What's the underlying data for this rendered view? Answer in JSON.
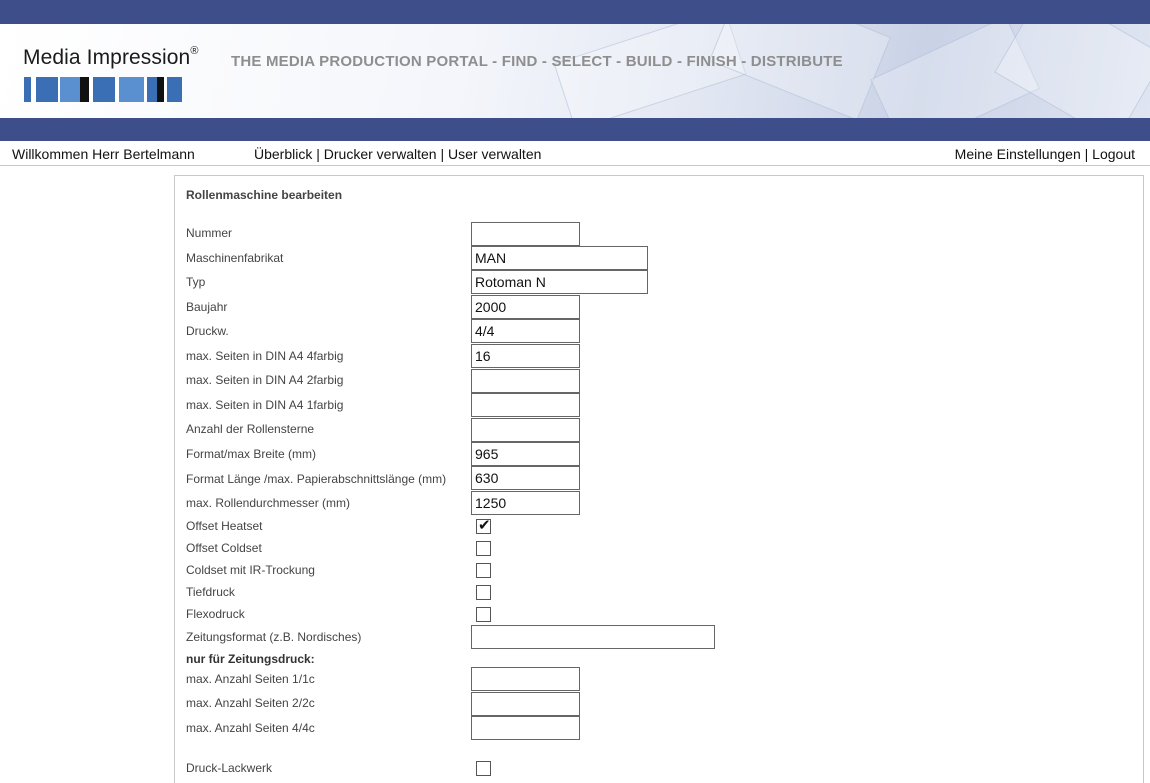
{
  "header": {
    "logo_text": "Media Impression",
    "logo_mark": "®",
    "tagline": "THE MEDIA PRODUCTION PORTAL - FIND - SELECT - BUILD - FINISH - DISTRIBUTE",
    "colors": {
      "stripe": "#3d4e8a",
      "block_blue": "#3a6fb5",
      "block_light": "#5a8fd0",
      "block_black": "#111111"
    }
  },
  "nav": {
    "welcome": "Willkommen Herr Bertelmann",
    "overview": "Überblick",
    "printers": "Drucker verwalten",
    "users": "User verwalten",
    "separator": " | ",
    "settings": "Meine Einstellungen",
    "logout": "Logout"
  },
  "form": {
    "title": "Rollenmaschine bearbeiten",
    "fields": {
      "nummer": {
        "label": "Nummer",
        "value": ""
      },
      "fabrikat": {
        "label": "Maschinenfabrikat",
        "value": "MAN"
      },
      "typ": {
        "label": "Typ",
        "value": "Rotoman N"
      },
      "baujahr": {
        "label": "Baujahr",
        "value": "2000"
      },
      "druckw": {
        "label": "Druckw.",
        "value": "4/4"
      },
      "seiten4": {
        "label": "max. Seiten in DIN A4 4farbig",
        "value": "16"
      },
      "seiten2": {
        "label": "max. Seiten in DIN A4 2farbig",
        "value": ""
      },
      "seiten1": {
        "label": "max. Seiten in DIN A4 1farbig",
        "value": ""
      },
      "rollensterne": {
        "label": "Anzahl der Rollensterne",
        "value": ""
      },
      "breite": {
        "label": "Format/max Breite (mm)",
        "value": "965"
      },
      "laenge": {
        "label": "Format Länge /max. Papierabschnittslänge (mm)",
        "value": "630"
      },
      "durchmesser": {
        "label": "max. Rollendurchmesser (mm)",
        "value": "1250"
      },
      "zeitungsformat": {
        "label": "Zeitungsformat  (z.B. Nordisches)",
        "value": ""
      },
      "anz_1c": {
        "label": "max. Anzahl Seiten 1/1c",
        "value": ""
      },
      "anz_2c": {
        "label": "max. Anzahl Seiten 2/2c",
        "value": ""
      },
      "anz_4c": {
        "label": "max. Anzahl Seiten 4/4c",
        "value": ""
      }
    },
    "checkboxes": {
      "heatset": {
        "label": "Offset Heatset",
        "checked": true,
        "mark": "✔"
      },
      "coldset": {
        "label": "Offset Coldset",
        "checked": false
      },
      "ir": {
        "label": "Coldset mit IR-Trockung",
        "checked": false
      },
      "tiefdruck": {
        "label": "Tiefdruck",
        "checked": false
      },
      "flexodruck": {
        "label": "Flexodruck",
        "checked": false
      },
      "lackwerk": {
        "label": "Druck-Lackwerk",
        "checked": false
      }
    },
    "section_newspaper": "nur für Zeitungsdruck:"
  }
}
